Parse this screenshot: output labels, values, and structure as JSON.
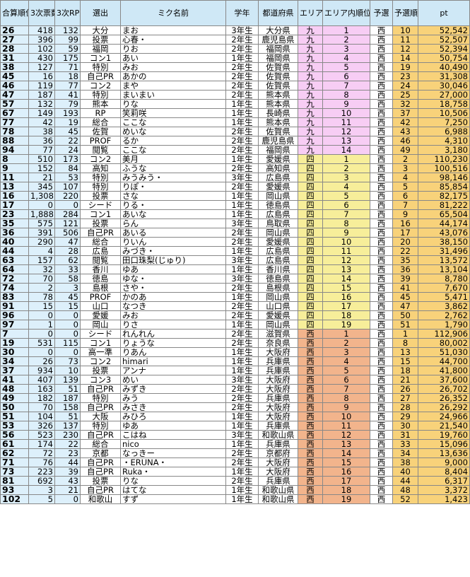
{
  "headers": {
    "rank": "合算順位",
    "votes": "3次票数",
    "rp": "3次RP数",
    "selection": "選出",
    "name": "ミク名前",
    "grade": "学年",
    "pref": "都道府県",
    "area": "エリア",
    "area_rank": "エリア内順位",
    "yosen": "予選",
    "yosen_rank": "予選順位",
    "pt": "pt"
  },
  "colors": {
    "header_bg": "#cfe8f6",
    "kyushu_bg": "#f7cdf4",
    "shikoku_bg": "#f7ee9a",
    "nishi_bg": "#f2b48c",
    "pt_bg": "#f8d27a"
  },
  "rows": [
    {
      "rank": "26",
      "votes": "418",
      "rp": "132",
      "sel": "大分",
      "name": "まお",
      "grade": "3年生",
      "pref": "大分県",
      "area": "九",
      "arank": "1",
      "yosen": "西",
      "yrank": "10",
      "pt": "52,542",
      "g": "kyu"
    },
    {
      "rank": "27",
      "votes": "396",
      "rp": "99",
      "sel": "投票",
      "name": "心春・",
      "grade": "2年生",
      "pref": "鹿児島県",
      "area": "九",
      "arank": "2",
      "yosen": "西",
      "yrank": "11",
      "pt": "52,507",
      "g": "kyu"
    },
    {
      "rank": "28",
      "votes": "102",
      "rp": "59",
      "sel": "福岡",
      "name": "りお",
      "grade": "2年生",
      "pref": "福岡県",
      "area": "九",
      "arank": "3",
      "yosen": "西",
      "yrank": "12",
      "pt": "52,394",
      "g": "kyu"
    },
    {
      "rank": "31",
      "votes": "430",
      "rp": "175",
      "sel": "コン1",
      "name": "あい",
      "grade": "1年生",
      "pref": "福岡県",
      "area": "九",
      "arank": "4",
      "yosen": "西",
      "yrank": "14",
      "pt": "50,754",
      "g": "kyu"
    },
    {
      "rank": "38",
      "votes": "127",
      "rp": "71",
      "sel": "特別",
      "name": "みお",
      "grade": "2年生",
      "pref": "佐賀県",
      "area": "九",
      "arank": "5",
      "yosen": "西",
      "yrank": "19",
      "pt": "40,490",
      "g": "kyu"
    },
    {
      "rank": "45",
      "votes": "16",
      "rp": "18",
      "sel": "自己PR",
      "name": "あかの",
      "grade": "2年生",
      "pref": "佐賀県",
      "area": "九",
      "arank": "6",
      "yosen": "西",
      "yrank": "23",
      "pt": "31,308",
      "g": "kyu"
    },
    {
      "rank": "46",
      "votes": "119",
      "rp": "77",
      "sel": "コン2",
      "name": "まや",
      "grade": "2年生",
      "pref": "佐賀県",
      "area": "九",
      "arank": "7",
      "yosen": "西",
      "yrank": "24",
      "pt": "30,046",
      "g": "kyu"
    },
    {
      "rank": "47",
      "votes": "187",
      "rp": "41",
      "sel": "特別",
      "name": "まいまい",
      "grade": "2年生",
      "pref": "熊本県",
      "area": "九",
      "arank": "8",
      "yosen": "西",
      "yrank": "25",
      "pt": "27,000",
      "g": "kyu"
    },
    {
      "rank": "57",
      "votes": "132",
      "rp": "79",
      "sel": "熊本",
      "name": "りな",
      "grade": "1年生",
      "pref": "熊本県",
      "area": "九",
      "arank": "9",
      "yosen": "西",
      "yrank": "32",
      "pt": "18,758",
      "g": "kyu"
    },
    {
      "rank": "67",
      "votes": "149",
      "rp": "193",
      "sel": "RP",
      "name": "笑莉咲",
      "grade": "1年生",
      "pref": "長崎県",
      "area": "九",
      "arank": "10",
      "yosen": "西",
      "yrank": "37",
      "pt": "10,506",
      "g": "kyu"
    },
    {
      "rank": "77",
      "votes": "42",
      "rp": "19",
      "sel": "総合",
      "name": "ここな",
      "grade": "1年生",
      "pref": "熊本県",
      "area": "九",
      "arank": "11",
      "yosen": "西",
      "yrank": "42",
      "pt": "7,250",
      "g": "kyu"
    },
    {
      "rank": "78",
      "votes": "38",
      "rp": "45",
      "sel": "佐賀",
      "name": "めいな",
      "grade": "2年生",
      "pref": "佐賀県",
      "area": "九",
      "arank": "12",
      "yosen": "西",
      "yrank": "43",
      "pt": "6,988",
      "g": "kyu"
    },
    {
      "rank": "88",
      "votes": "36",
      "rp": "22",
      "sel": "PROF",
      "name": "るか",
      "grade": "2年生",
      "pref": "鹿児島県",
      "area": "九",
      "arank": "13",
      "yosen": "西",
      "yrank": "46",
      "pt": "4,310",
      "g": "kyu"
    },
    {
      "rank": "94",
      "votes": "77",
      "rp": "24",
      "sel": "閲覧",
      "name": "ここな",
      "grade": "2年生",
      "pref": "福岡県",
      "area": "九",
      "arank": "14",
      "yosen": "西",
      "yrank": "49",
      "pt": "3,180",
      "g": "kyu"
    },
    {
      "rank": "8",
      "votes": "510",
      "rp": "173",
      "sel": "コン2",
      "name": "美月",
      "grade": "1年生",
      "pref": "愛媛県",
      "area": "四",
      "arank": "1",
      "yosen": "西",
      "yrank": "2",
      "pt": "110,230",
      "g": "shi"
    },
    {
      "rank": "9",
      "votes": "152",
      "rp": "84",
      "sel": "高知",
      "name": "ふうな",
      "grade": "2年生",
      "pref": "高知県",
      "area": "四",
      "arank": "2",
      "yosen": "西",
      "yrank": "3",
      "pt": "100,516",
      "g": "shi"
    },
    {
      "rank": "11",
      "votes": "21",
      "rp": "53",
      "sel": "特別",
      "name": "みうみう・",
      "grade": "3年生",
      "pref": "広島県",
      "area": "四",
      "arank": "3",
      "yosen": "西",
      "yrank": "4",
      "pt": "98,146",
      "g": "shi"
    },
    {
      "rank": "13",
      "votes": "345",
      "rp": "107",
      "sel": "特別",
      "name": "りぽ・",
      "grade": "2年生",
      "pref": "愛媛県",
      "area": "四",
      "arank": "4",
      "yosen": "西",
      "yrank": "5",
      "pt": "85,854",
      "g": "shi"
    },
    {
      "rank": "16",
      "votes": "1,308",
      "rp": "220",
      "sel": "投票",
      "name": "さな",
      "grade": "1年生",
      "pref": "岡山県",
      "area": "四",
      "arank": "5",
      "yosen": "西",
      "yrank": "6",
      "pt": "82,175",
      "g": "shi"
    },
    {
      "rank": "17",
      "votes": "0",
      "rp": "0",
      "sel": "シード",
      "name": "りる・",
      "grade": "1年生",
      "pref": "徳島県",
      "area": "四",
      "arank": "6",
      "yosen": "西",
      "yrank": "7",
      "pt": "81,222",
      "g": "shi"
    },
    {
      "rank": "23",
      "votes": "1,888",
      "rp": "284",
      "sel": "コン1",
      "name": "あいな",
      "grade": "1年生",
      "pref": "広島県",
      "area": "四",
      "arank": "7",
      "yosen": "西",
      "yrank": "9",
      "pt": "65,504",
      "g": "shi"
    },
    {
      "rank": "35",
      "votes": "575",
      "rp": "121",
      "sel": "投票",
      "name": "らん",
      "grade": "3年生",
      "pref": "鳥取県",
      "area": "四",
      "arank": "8",
      "yosen": "西",
      "yrank": "16",
      "pt": "44,174",
      "g": "shi"
    },
    {
      "rank": "36",
      "votes": "391",
      "rp": "506",
      "sel": "自己PR",
      "name": "あいる",
      "grade": "2年生",
      "pref": "岡山県",
      "area": "四",
      "arank": "9",
      "yosen": "西",
      "yrank": "17",
      "pt": "43,076",
      "g": "shi"
    },
    {
      "rank": "40",
      "votes": "290",
      "rp": "47",
      "sel": "総合",
      "name": "りいん",
      "grade": "2年生",
      "pref": "愛媛県",
      "area": "四",
      "arank": "10",
      "yosen": "西",
      "yrank": "20",
      "pt": "38,150",
      "g": "shi"
    },
    {
      "rank": "44",
      "votes": "4",
      "rp": "28",
      "sel": "広島",
      "name": "みづき・",
      "grade": "1年生",
      "pref": "広島県",
      "area": "四",
      "arank": "11",
      "yosen": "西",
      "yrank": "22",
      "pt": "31,496",
      "g": "shi"
    },
    {
      "rank": "63",
      "votes": "157",
      "rp": "62",
      "sel": "閲覧",
      "name": "田口珠梨(じゅり)",
      "grade": "3年生",
      "pref": "広島県",
      "area": "四",
      "arank": "12",
      "yosen": "西",
      "yrank": "35",
      "pt": "13,572",
      "g": "shi"
    },
    {
      "rank": "64",
      "votes": "32",
      "rp": "33",
      "sel": "香川",
      "name": "ゆあ",
      "grade": "1年生",
      "pref": "香川県",
      "area": "四",
      "arank": "13",
      "yosen": "西",
      "yrank": "36",
      "pt": "13,104",
      "g": "shi"
    },
    {
      "rank": "72",
      "votes": "70",
      "rp": "58",
      "sel": "徳島",
      "name": "ゆな・",
      "grade": "3年生",
      "pref": "徳島県",
      "area": "四",
      "arank": "14",
      "yosen": "西",
      "yrank": "39",
      "pt": "8,780",
      "g": "shi"
    },
    {
      "rank": "74",
      "votes": "2",
      "rp": "3",
      "sel": "島根",
      "name": "さや・",
      "grade": "2年生",
      "pref": "島根県",
      "area": "四",
      "arank": "15",
      "yosen": "西",
      "yrank": "41",
      "pt": "7,670",
      "g": "shi"
    },
    {
      "rank": "83",
      "votes": "78",
      "rp": "45",
      "sel": "PROF",
      "name": "かのあ",
      "grade": "1年生",
      "pref": "岡山県",
      "area": "四",
      "arank": "16",
      "yosen": "西",
      "yrank": "45",
      "pt": "5,471",
      "g": "shi"
    },
    {
      "rank": "91",
      "votes": "15",
      "rp": "15",
      "sel": "山口",
      "name": "なつき",
      "grade": "2年生",
      "pref": "山口県",
      "area": "四",
      "arank": "17",
      "yosen": "西",
      "yrank": "47",
      "pt": "3,862",
      "g": "shi"
    },
    {
      "rank": "96",
      "votes": "0",
      "rp": "0",
      "sel": "愛媛",
      "name": "みお",
      "grade": "2年生",
      "pref": "愛媛県",
      "area": "四",
      "arank": "18",
      "yosen": "西",
      "yrank": "50",
      "pt": "2,762",
      "g": "shi"
    },
    {
      "rank": "97",
      "votes": "1",
      "rp": "0",
      "sel": "岡山",
      "name": "りさ",
      "grade": "1年生",
      "pref": "岡山県",
      "area": "四",
      "arank": "19",
      "yosen": "西",
      "yrank": "51",
      "pt": "1,790",
      "g": "shi"
    },
    {
      "rank": "7",
      "votes": "0",
      "rp": "0",
      "sel": "シード",
      "name": "れんれん",
      "grade": "2年生",
      "pref": "滋賀県",
      "area": "西",
      "arank": "1",
      "yosen": "西",
      "yrank": "1",
      "pt": "112,906",
      "g": "nishi"
    },
    {
      "rank": "19",
      "votes": "531",
      "rp": "115",
      "sel": "コン1",
      "name": "りょうな",
      "grade": "2年生",
      "pref": "奈良県",
      "area": "西",
      "arank": "2",
      "yosen": "西",
      "yrank": "8",
      "pt": "80,002",
      "g": "nishi"
    },
    {
      "rank": "30",
      "votes": "0",
      "rp": "0",
      "sel": "高一準",
      "name": "りあん",
      "grade": "1年生",
      "pref": "大阪府",
      "area": "西",
      "arank": "3",
      "yosen": "西",
      "yrank": "13",
      "pt": "51,030",
      "g": "nishi"
    },
    {
      "rank": "34",
      "votes": "26",
      "rp": "73",
      "sel": "コン2",
      "name": "himari",
      "grade": "1年生",
      "pref": "兵庫県",
      "area": "西",
      "arank": "4",
      "yosen": "西",
      "yrank": "15",
      "pt": "44,700",
      "g": "nishi"
    },
    {
      "rank": "37",
      "votes": "934",
      "rp": "10",
      "sel": "投票",
      "name": "アンナ",
      "grade": "1年生",
      "pref": "兵庫県",
      "area": "西",
      "arank": "5",
      "yosen": "西",
      "yrank": "18",
      "pt": "41,800",
      "g": "nishi"
    },
    {
      "rank": "41",
      "votes": "407",
      "rp": "139",
      "sel": "コン3",
      "name": "めい",
      "grade": "3年生",
      "pref": "大阪府",
      "area": "西",
      "arank": "6",
      "yosen": "西",
      "yrank": "21",
      "pt": "37,600",
      "g": "nishi"
    },
    {
      "rank": "48",
      "votes": "163",
      "rp": "51",
      "sel": "自己PR",
      "name": "みずき",
      "grade": "2年生",
      "pref": "大阪府",
      "area": "西",
      "arank": "7",
      "yosen": "西",
      "yrank": "26",
      "pt": "26,702",
      "g": "nishi"
    },
    {
      "rank": "49",
      "votes": "182",
      "rp": "187",
      "sel": "特別",
      "name": "みう",
      "grade": "2年生",
      "pref": "兵庫県",
      "area": "西",
      "arank": "8",
      "yosen": "西",
      "yrank": "27",
      "pt": "26,352",
      "g": "nishi"
    },
    {
      "rank": "50",
      "votes": "70",
      "rp": "158",
      "sel": "自己PR",
      "name": "みさき",
      "grade": "2年生",
      "pref": "大阪府",
      "area": "西",
      "arank": "9",
      "yosen": "西",
      "yrank": "28",
      "pt": "26,292",
      "g": "nishi"
    },
    {
      "rank": "51",
      "votes": "104",
      "rp": "51",
      "sel": "大阪",
      "name": "みひろ",
      "grade": "1年生",
      "pref": "大阪府",
      "area": "西",
      "arank": "10",
      "yosen": "西",
      "yrank": "29",
      "pt": "24,966",
      "g": "nishi"
    },
    {
      "rank": "53",
      "votes": "326",
      "rp": "137",
      "sel": "特別",
      "name": "ゆあ",
      "grade": "1年生",
      "pref": "兵庫県",
      "area": "西",
      "arank": "11",
      "yosen": "西",
      "yrank": "30",
      "pt": "21,540",
      "g": "nishi"
    },
    {
      "rank": "56",
      "votes": "523",
      "rp": "230",
      "sel": "自己PR",
      "name": "こはね",
      "grade": "3年生",
      "pref": "和歌山県",
      "area": "西",
      "arank": "12",
      "yosen": "西",
      "yrank": "31",
      "pt": "19,760",
      "g": "nishi"
    },
    {
      "rank": "61",
      "votes": "174",
      "rp": "22",
      "sel": "総合",
      "name": "nico",
      "grade": "1年生",
      "pref": "兵庫県",
      "area": "西",
      "arank": "13",
      "yosen": "西",
      "yrank": "33",
      "pt": "15,096",
      "g": "nishi"
    },
    {
      "rank": "62",
      "votes": "72",
      "rp": "23",
      "sel": "京都",
      "name": "なっきー",
      "grade": "2年生",
      "pref": "京都府",
      "area": "西",
      "arank": "14",
      "yosen": "西",
      "yrank": "34",
      "pt": "13,636",
      "g": "nishi"
    },
    {
      "rank": "71",
      "votes": "76",
      "rp": "44",
      "sel": "自己PR",
      "name": "・ERUNA・",
      "grade": "2年生",
      "pref": "大阪府",
      "area": "西",
      "arank": "15",
      "yosen": "西",
      "yrank": "38",
      "pt": "9,000",
      "g": "nishi"
    },
    {
      "rank": "73",
      "votes": "223",
      "rp": "39",
      "sel": "自己PR",
      "name": "Ruka・",
      "grade": "1年生",
      "pref": "大阪府",
      "area": "西",
      "arank": "16",
      "yosen": "西",
      "yrank": "40",
      "pt": "8,404",
      "g": "nishi"
    },
    {
      "rank": "81",
      "votes": "692",
      "rp": "43",
      "sel": "投票",
      "name": "りな",
      "grade": "2年生",
      "pref": "兵庫県",
      "area": "西",
      "arank": "17",
      "yosen": "西",
      "yrank": "44",
      "pt": "6,317",
      "g": "nishi"
    },
    {
      "rank": "93",
      "votes": "3",
      "rp": "21",
      "sel": "自己PR",
      "name": "はてな",
      "grade": "1年生",
      "pref": "和歌山県",
      "area": "西",
      "arank": "18",
      "yosen": "西",
      "yrank": "48",
      "pt": "3,372",
      "g": "nishi"
    },
    {
      "rank": "102",
      "votes": "5",
      "rp": "0",
      "sel": "和歌山",
      "name": "すず",
      "grade": "1年生",
      "pref": "和歌山県",
      "area": "西",
      "arank": "19",
      "yosen": "西",
      "yrank": "52",
      "pt": "1,423",
      "g": "nishi"
    }
  ]
}
